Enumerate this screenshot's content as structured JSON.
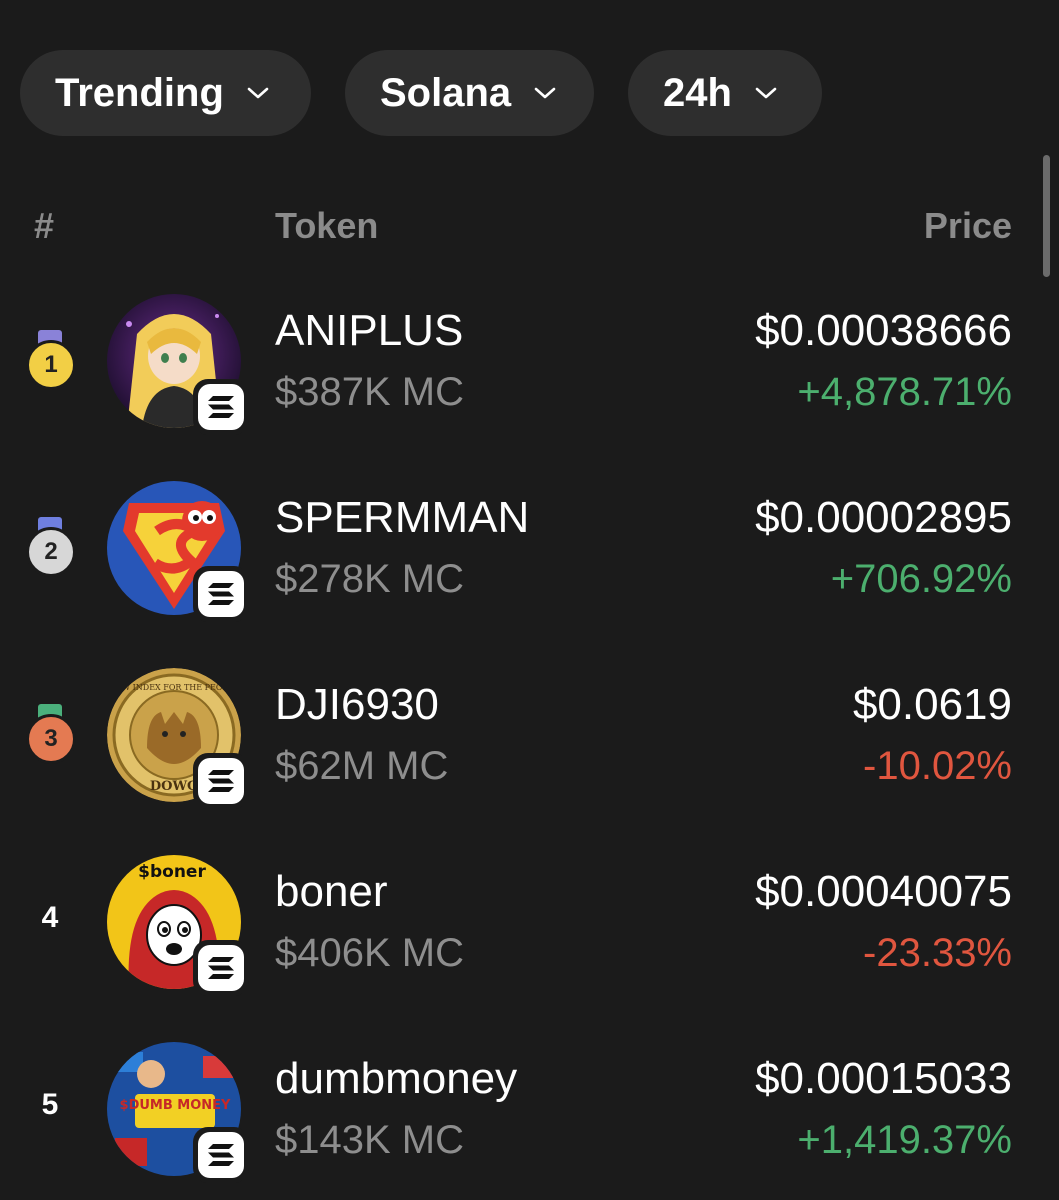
{
  "filters": [
    {
      "label": "Trending"
    },
    {
      "label": "Solana"
    },
    {
      "label": "24h"
    }
  ],
  "table": {
    "headers": {
      "rank": "#",
      "token": "Token",
      "price": "Price"
    }
  },
  "tokens": [
    {
      "rank": "1",
      "name": "ANIPLUS",
      "market_cap": "$387K MC",
      "price": "$0.00038666",
      "change": "+4,878.71%",
      "direction": "up",
      "medal": "gold",
      "chain": "solana"
    },
    {
      "rank": "2",
      "name": "SPERMMAN",
      "market_cap": "$278K MC",
      "price": "$0.00002895",
      "change": "+706.92%",
      "direction": "up",
      "medal": "silver",
      "chain": "solana"
    },
    {
      "rank": "3",
      "name": "DJI6930",
      "market_cap": "$62M MC",
      "price": "$0.0619",
      "change": "-10.02%",
      "direction": "down",
      "medal": "bronze",
      "chain": "solana"
    },
    {
      "rank": "4",
      "name": "boner",
      "market_cap": "$406K MC",
      "price": "$0.00040075",
      "change": "-23.33%",
      "direction": "down",
      "medal": "",
      "chain": "solana"
    },
    {
      "rank": "5",
      "name": "dumbmoney",
      "market_cap": "$143K MC",
      "price": "$0.00015033",
      "change": "+1,419.37%",
      "direction": "up",
      "medal": "",
      "chain": "solana"
    }
  ],
  "colors": {
    "background": "#1b1b1b",
    "chip": "#2e2e2e",
    "positive": "#4caf6e",
    "negative": "#e0563f",
    "muted": "#8e8e8e"
  },
  "avatar_text": {
    "boner": "$boner",
    "dumbmoney": "$DUMB MONEY",
    "dji_ring": "NEW INDEX FOR THE PEOPLE",
    "dji_bottom": "DOWG"
  },
  "icons": {
    "chevron": "chevron-down-icon",
    "chain": "solana-icon",
    "medal": "medal-icon"
  }
}
